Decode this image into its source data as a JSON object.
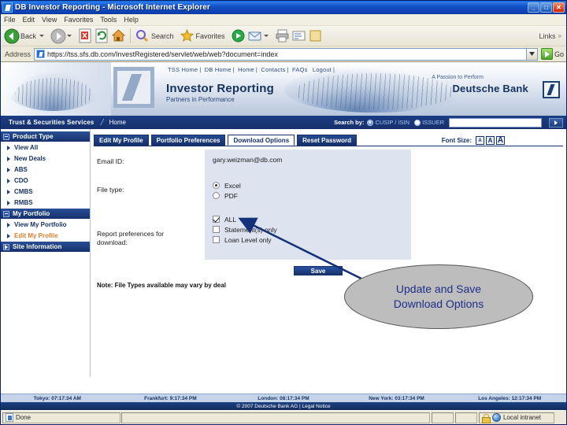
{
  "window": {
    "title": "DB Investor Reporting - Microsoft Internet Explorer",
    "icon": "ie-document-icon",
    "minimize_label": "_",
    "maximize_label": "□",
    "close_label": "✕"
  },
  "menu": {
    "items": [
      "File",
      "Edit",
      "View",
      "Favorites",
      "Tools",
      "Help"
    ]
  },
  "toolbar": {
    "back_label": "Back",
    "forward_label": "",
    "search_label": "Search",
    "favorites_label": "Favorites",
    "links_label": "Links",
    "icons": [
      "back-arrow-icon",
      "forward-arrow-icon",
      "stop-icon",
      "refresh-icon",
      "home-icon",
      "search-icon",
      "favorites-star-icon",
      "media-icon",
      "mail-icon",
      "print-icon",
      "edit-icon",
      "discuss-icon"
    ]
  },
  "address": {
    "label": "Address",
    "url": "https://tss.sfs.db.com/InvestRegistered/servlet/web/web?document=index",
    "go_label": "Go",
    "favicon": "page-icon"
  },
  "banner": {
    "nav_links": [
      "TSS Home",
      "DB Home",
      "Home",
      "Contacts",
      "FAQs",
      "Logout"
    ],
    "title": "Investor Reporting",
    "subtitle": "Partners in Performance",
    "slogan": "A Passion to Perform",
    "brand": "Deutsche Bank",
    "logo": "deutsche-bank-logo"
  },
  "subnav": {
    "section": "Trust & Securities Services",
    "breadcrumb": "Home",
    "search_label": "Search by:",
    "search_options": [
      {
        "label": "CUSIP / ISIN",
        "selected": true
      },
      {
        "label": "ISSUER",
        "selected": false
      }
    ],
    "search_value": "",
    "go_icon": "go-arrow-icon"
  },
  "sidebar": {
    "groups": [
      {
        "header": "Product Type",
        "expanded": true,
        "items": [
          {
            "label": "View All",
            "active": false
          },
          {
            "label": "New Deals",
            "active": false
          },
          {
            "label": "ABS",
            "active": false
          },
          {
            "label": "CDO",
            "active": false
          },
          {
            "label": "CMBS",
            "active": false
          },
          {
            "label": "RMBS",
            "active": false
          }
        ]
      },
      {
        "header": "My Portfolio",
        "expanded": true,
        "items": [
          {
            "label": "View My Portfolio",
            "active": false
          },
          {
            "label": "Edit My Profile",
            "active": true
          }
        ]
      },
      {
        "header": "Site Information",
        "expanded": false,
        "items": []
      }
    ]
  },
  "tabs": [
    {
      "label": "Edit My Profile",
      "active": false
    },
    {
      "label": "Portfolio Preferences",
      "active": false
    },
    {
      "label": "Download Options",
      "active": true
    },
    {
      "label": "Reset Password",
      "active": false
    }
  ],
  "font_size": {
    "label": "Font Size:",
    "options": [
      "A",
      "A",
      "A"
    ]
  },
  "form": {
    "email_label": "Email ID:",
    "email_value": "gary.weizman@db.com",
    "filetype_label": "File type:",
    "filetype_options": [
      {
        "label": "Excel",
        "selected": true
      },
      {
        "label": "PDF",
        "selected": false
      }
    ],
    "report_label_line1": "Report preferences for",
    "report_label_line2": "download:",
    "report_options": [
      {
        "label": "ALL",
        "checked": true
      },
      {
        "label": "Statement(s) only",
        "checked": false
      },
      {
        "label": "Loan Level only",
        "checked": false
      }
    ],
    "save_label": "Save",
    "note": "Note: File Types available may vary by deal"
  },
  "callout": {
    "line1": "Update and Save",
    "line2": "Download Options",
    "fill_color": "#bdbdbd",
    "text_color": "#1f2f8a",
    "arrow_color": "#14307a"
  },
  "footer": {
    "timezones": [
      "Tokyo: 07:17:34 AM",
      "Frankfurt: 9:17:34 PM",
      "London: 08:17:34 PM",
      "New York: 03:17:34 PM",
      "Los Angeles: 12:17:34 PM"
    ],
    "copyright": "© 2007 Deutsche Bank AG | Legal Notice"
  },
  "statusbar": {
    "status": "Done",
    "zone": "Local intranet",
    "lock_icon": "secure-lock-icon",
    "zone_icon": "globe-icon"
  }
}
